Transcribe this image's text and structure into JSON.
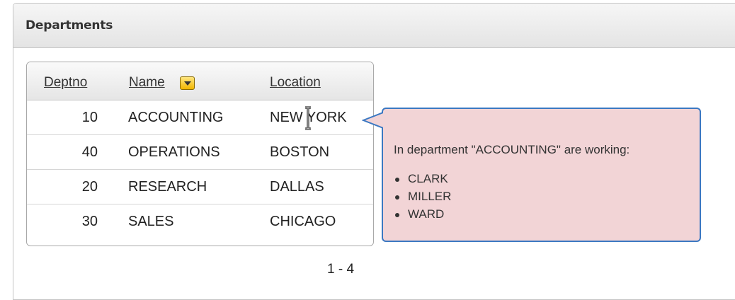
{
  "region": {
    "title": "Departments"
  },
  "report": {
    "columns": {
      "deptno": "Deptno",
      "name": "Name",
      "location": "Location"
    },
    "rows": [
      {
        "deptno": "10",
        "name": "ACCOUNTING",
        "location": "NEW YORK"
      },
      {
        "deptno": "40",
        "name": "OPERATIONS",
        "location": "BOSTON"
      },
      {
        "deptno": "20",
        "name": "RESEARCH",
        "location": "DALLAS"
      },
      {
        "deptno": "30",
        "name": "SALES",
        "location": "CHICAGO"
      }
    ],
    "pagination": "1 - 4"
  },
  "tooltip": {
    "title": "In department \"ACCOUNTING\" are working:",
    "employees": [
      "CLARK",
      "MILLER",
      "WARD"
    ]
  },
  "colors": {
    "tooltip_bg": "#f2d4d6",
    "tooltip_border": "#3b78c2",
    "sort_button": "#f2b600"
  },
  "icons": {
    "sort": "chevron-down-icon",
    "cursor": "text-cursor-icon"
  }
}
